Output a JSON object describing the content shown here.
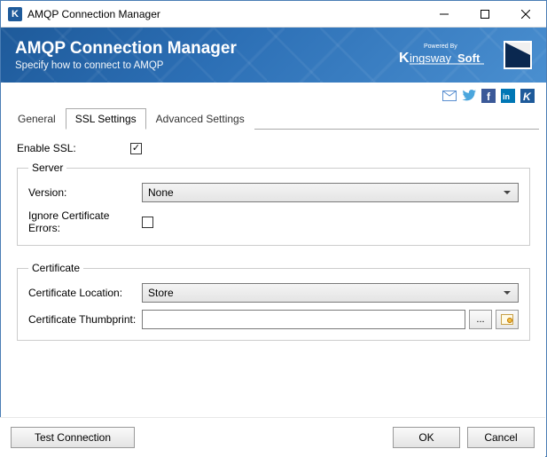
{
  "window": {
    "title": "AMQP Connection Manager"
  },
  "banner": {
    "title": "AMQP Connection Manager",
    "subtitle": "Specify how to connect to AMQP",
    "powered_by": "Powered By",
    "brand": "KingswaySoft"
  },
  "tabs": {
    "general": "General",
    "ssl": "SSL Settings",
    "advanced": "Advanced Settings",
    "active": "ssl"
  },
  "form": {
    "enable_ssl_label": "Enable SSL:",
    "enable_ssl_checked": true,
    "server_legend": "Server",
    "version_label": "Version:",
    "version_value": "None",
    "ignore_cert_label": "Ignore Certificate Errors:",
    "ignore_cert_checked": false,
    "cert_legend": "Certificate",
    "cert_location_label": "Certificate Location:",
    "cert_location_value": "Store",
    "cert_thumb_label": "Certificate Thumbprint:",
    "cert_thumb_value": "",
    "browse_label": "..."
  },
  "footer": {
    "test": "Test Connection",
    "ok": "OK",
    "cancel": "Cancel"
  }
}
